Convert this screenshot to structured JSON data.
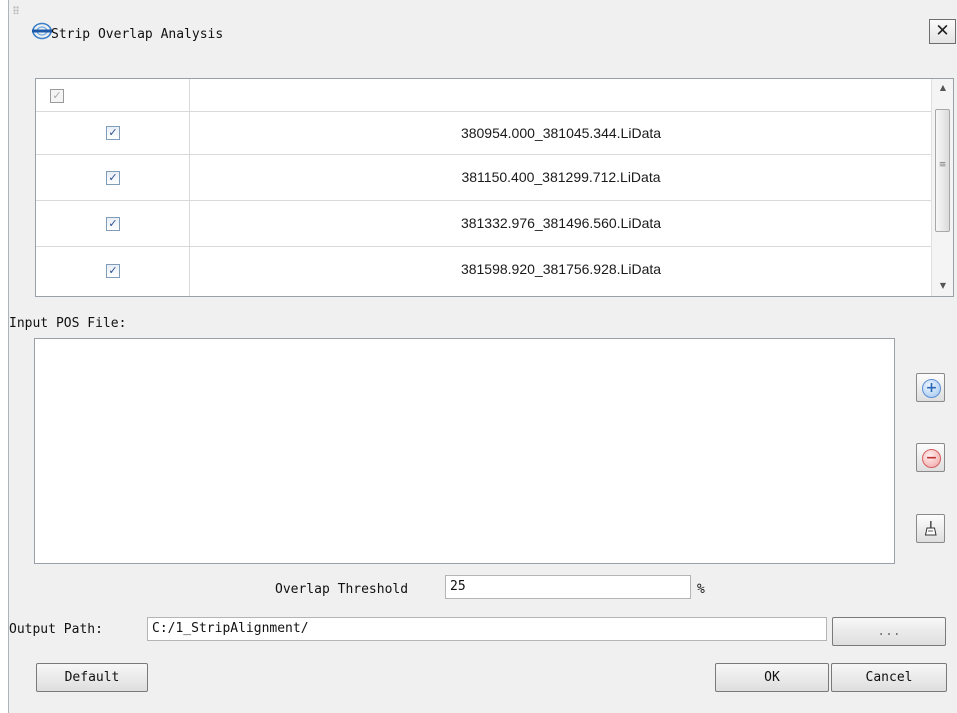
{
  "window": {
    "title": "Strip Overlap Analysis",
    "close_glyph": "✕",
    "logo_icon": "lidar-logo-icon"
  },
  "file_table": {
    "header_checked": true,
    "rows": [
      {
        "checked": true,
        "file": "380954.000_381045.344.LiData"
      },
      {
        "checked": true,
        "file": "381150.400_381299.712.LiData"
      },
      {
        "checked": true,
        "file": "381332.976_381496.560.LiData"
      },
      {
        "checked": true,
        "file": "381598.920_381756.928.LiData"
      }
    ]
  },
  "pos": {
    "label": "Input POS File:",
    "items": []
  },
  "side_buttons": {
    "add_icon": "add-circle-icon",
    "remove_icon": "remove-circle-icon",
    "clear_icon": "brush-icon"
  },
  "threshold": {
    "label": "Overlap Threshold",
    "value": "25",
    "unit": "%"
  },
  "output": {
    "label": "Output Path:",
    "value": "C:/1_StripAlignment/",
    "browse_label": "..."
  },
  "footer": {
    "default_label": "Default",
    "ok_label": "OK",
    "cancel_label": "Cancel"
  }
}
